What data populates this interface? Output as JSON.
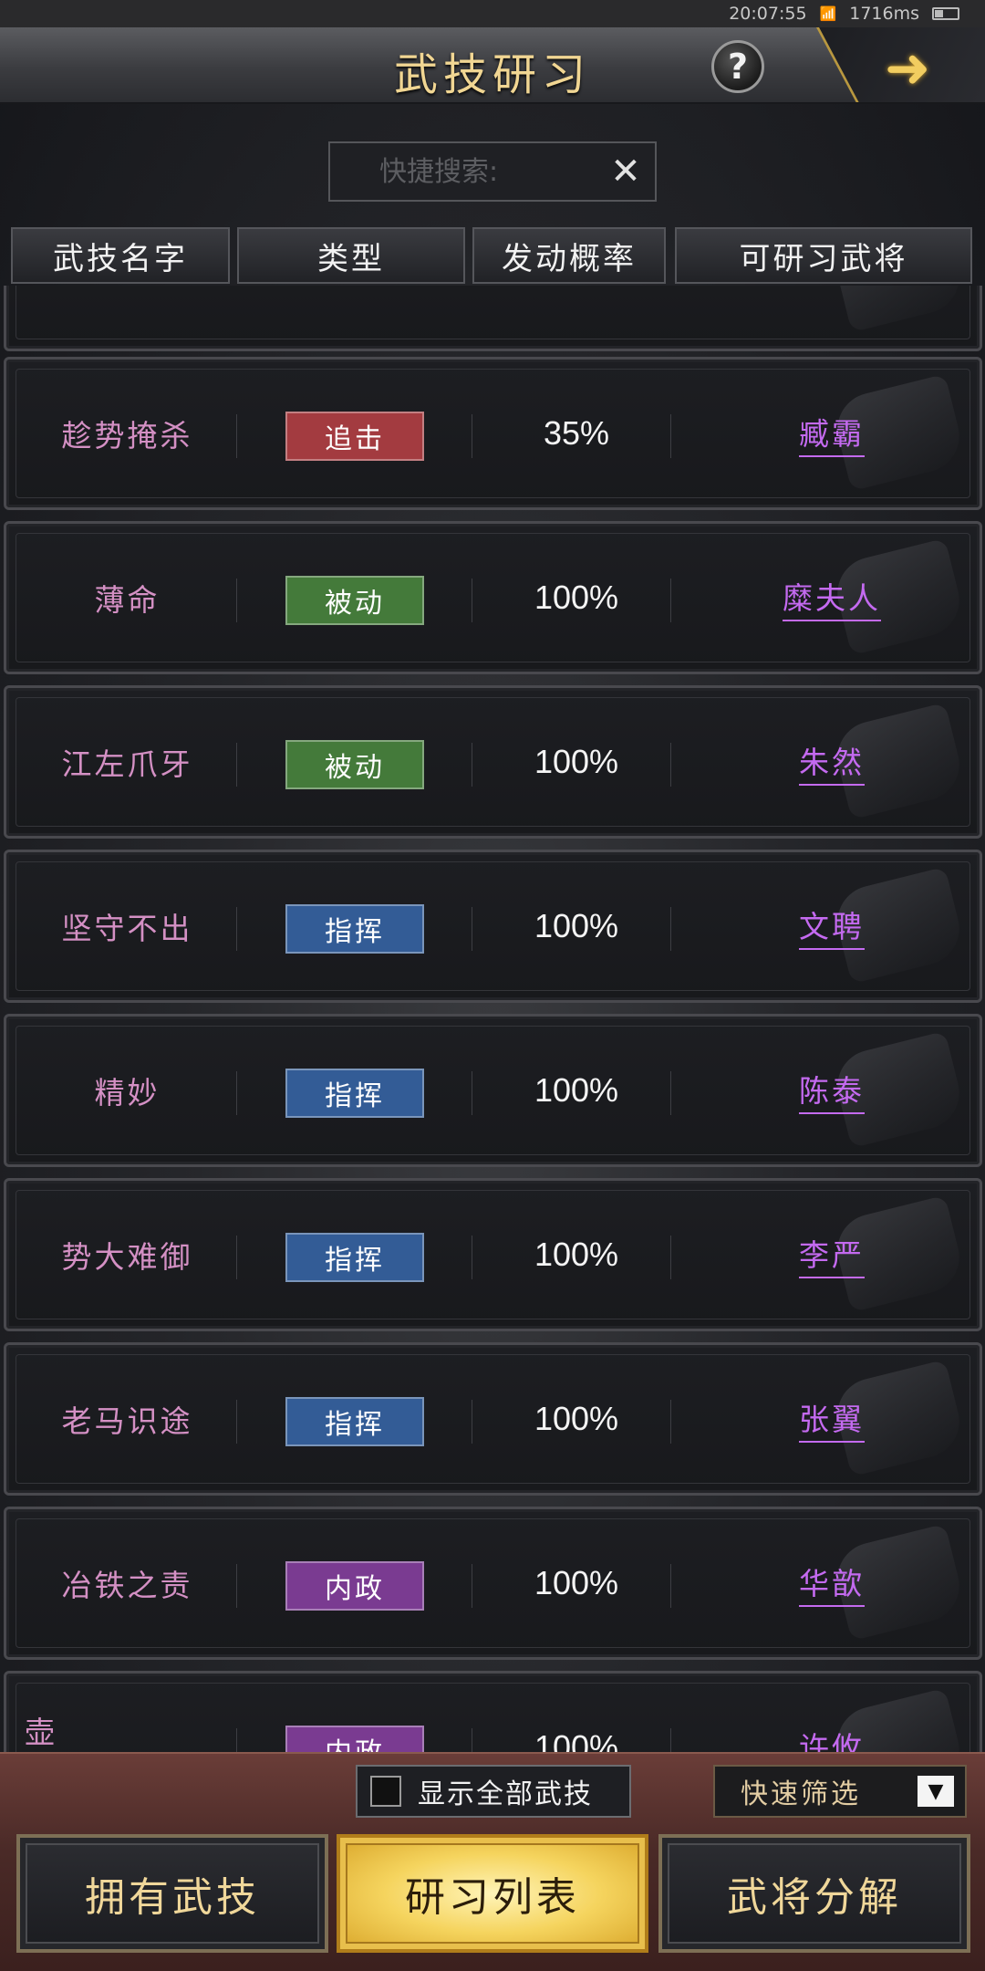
{
  "status_bar": {
    "time": "20:07:55",
    "latency": "1716ms"
  },
  "header": {
    "title": "武技研习",
    "help_label": "?"
  },
  "search": {
    "placeholder": "快捷搜索:",
    "value": ""
  },
  "columns": [
    "武技名字",
    "类型",
    "发动概率",
    "可研习武将"
  ],
  "type_colors": {
    "追击": "#a33b40",
    "被动": "#447a3a",
    "指挥": "#335c96",
    "内政": "#7a3b91"
  },
  "rows": [
    {
      "name": "趁势掩杀",
      "type": "追击",
      "rate": "35%",
      "general": "臧霸"
    },
    {
      "name": "薄命",
      "type": "被动",
      "rate": "100%",
      "general": "糜夫人"
    },
    {
      "name": "江左爪牙",
      "type": "被动",
      "rate": "100%",
      "general": "朱然"
    },
    {
      "name": "坚守不出",
      "type": "指挥",
      "rate": "100%",
      "general": "文聘"
    },
    {
      "name": "精妙",
      "type": "指挥",
      "rate": "100%",
      "general": "陈泰"
    },
    {
      "name": "势大难御",
      "type": "指挥",
      "rate": "100%",
      "general": "李严"
    },
    {
      "name": "老马识途",
      "type": "指挥",
      "rate": "100%",
      "general": "张翼"
    },
    {
      "name": "冶铁之责",
      "type": "内政",
      "rate": "100%",
      "general": "华歆"
    },
    {
      "name": "壶onDestroy",
      "type": "内政",
      "rate": "100%",
      "general": "许攸"
    }
  ],
  "bottom": {
    "show_all_label": "显示全部武技",
    "filter_label": "快速筛选",
    "tabs": [
      "拥有武技",
      "研习列表",
      "武将分解"
    ],
    "active_tab": "研习列表"
  }
}
